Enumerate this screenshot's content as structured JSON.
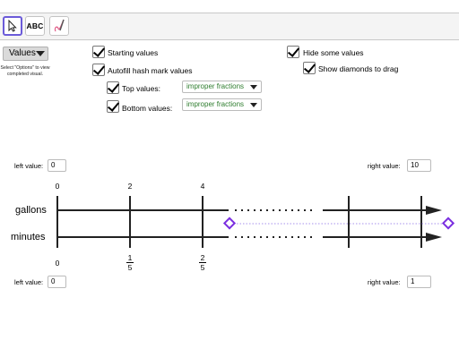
{
  "toolbar": {
    "select_tool_icon": "cursor-arrow-icon",
    "text_tool_label": "ABC",
    "pen_tool_icon": "pen-icon"
  },
  "menu": {
    "values_label": "Values",
    "hint": "Select \"Options\" to view completed visual."
  },
  "options": {
    "starting_values": "Starting values",
    "autofill": "Autofill hash mark values",
    "top_values_label": "Top values:",
    "top_values_select": "improper fractions",
    "bottom_values_label": "Bottom values:",
    "bottom_values_select": "improper fractions",
    "hide_some_values": "Hide some values",
    "show_diamonds": "Show diamonds to drag"
  },
  "top_range": {
    "left_label": "left value:",
    "left_value": "0",
    "right_label": "right value:",
    "right_value": "10"
  },
  "bottom_range": {
    "left_label": "left value:",
    "left_value": "0",
    "right_label": "right value:",
    "right_value": "1"
  },
  "lines": {
    "top_label": "gallons",
    "bottom_label": "minutes",
    "top_ticks": [
      "0",
      "2",
      "4"
    ],
    "bottom_ticks": [
      {
        "whole": "0"
      },
      {
        "num": "1",
        "den": "5"
      },
      {
        "num": "2",
        "den": "5"
      }
    ]
  },
  "colors": {
    "accent": "#6b5bd9",
    "diamond": "#7b2fe0",
    "select_text": "#2e7d2e"
  }
}
